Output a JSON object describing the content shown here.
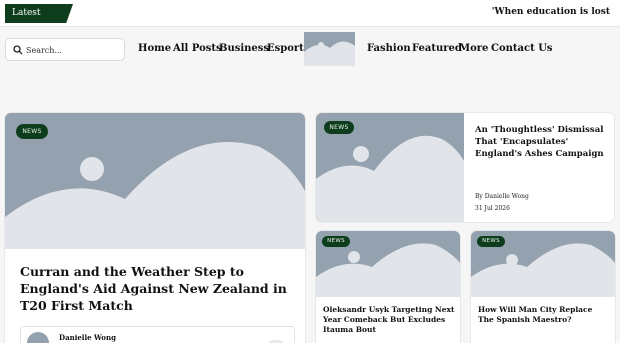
{
  "topbar": {
    "latest_label": "Latest Update",
    "ticker_text": "'When education is lost"
  },
  "search": {
    "placeholder": "Search..."
  },
  "nav": {
    "left": [
      "Home",
      "All Posts",
      "Business",
      "Esports"
    ],
    "right": [
      "Fashion",
      "Featured",
      "More",
      "Contact Us"
    ]
  },
  "colors": {
    "accent": "#0d3d1c",
    "placeholder": "#94a1ae"
  },
  "featured": {
    "category": "NEWS",
    "title": "Curran and the Weather Step to England's Aid Against New Zealand in T20 First Match",
    "author": "Danielle Wong"
  },
  "side_top": {
    "category": "NEWS",
    "title": "An 'Thoughtless' Dismissal That 'Encapsulates' England's Ashes Campaign",
    "author": "By Danielle Wong",
    "date": "31 Jul 2026"
  },
  "small_cards": [
    {
      "category": "NEWS",
      "title": "Oleksandr Usyk Targeting Next Year Comeback But Excludes Itauma Bout"
    },
    {
      "category": "NEWS",
      "title": "How Will Man City Replace The Spanish Maestro?"
    }
  ]
}
